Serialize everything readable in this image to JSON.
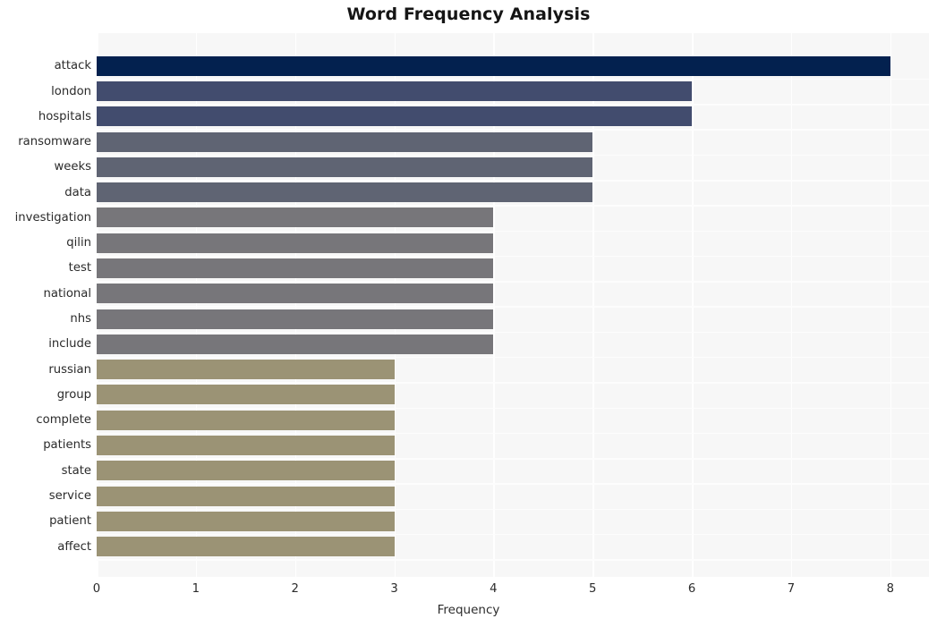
{
  "chart_data": {
    "type": "bar",
    "orientation": "horizontal",
    "title": "Word Frequency Analysis",
    "xlabel": "Frequency",
    "ylabel": "",
    "xlim": [
      0,
      8.39
    ],
    "xticks": [
      0,
      1,
      2,
      3,
      4,
      5,
      6,
      7,
      8
    ],
    "xtick_labels": [
      "0",
      "1",
      "2",
      "3",
      "4",
      "5",
      "6",
      "7",
      "8"
    ],
    "grid": true,
    "legend": null,
    "categories": [
      "attack",
      "london",
      "hospitals",
      "ransomware",
      "weeks",
      "data",
      "investigation",
      "qilin",
      "test",
      "national",
      "nhs",
      "include",
      "russian",
      "group",
      "complete",
      "patients",
      "state",
      "service",
      "patient",
      "affect"
    ],
    "values": [
      8,
      6,
      6,
      5,
      5,
      5,
      4,
      4,
      4,
      4,
      4,
      4,
      3,
      3,
      3,
      3,
      3,
      3,
      3,
      3
    ],
    "bar_colors": [
      "#03214f",
      "#424c6e",
      "#424c6e",
      "#5f6473",
      "#5f6473",
      "#5f6473",
      "#77767a",
      "#77767a",
      "#77767a",
      "#77767a",
      "#77767a",
      "#77767a",
      "#9b9375",
      "#9b9375",
      "#9b9375",
      "#9b9375",
      "#9b9375",
      "#9b9375",
      "#9b9375",
      "#9b9375"
    ],
    "plot_background": "#f7f7f7",
    "gridline_color": "#ffffff",
    "figure_background": "#ffffff"
  }
}
